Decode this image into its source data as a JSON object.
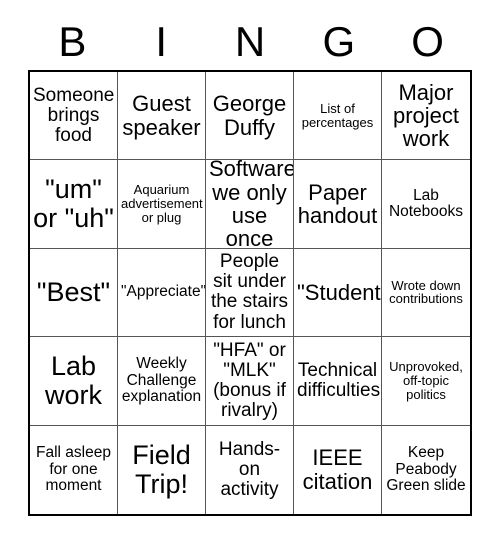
{
  "card": {
    "header_letters": [
      "B",
      "I",
      "N",
      "G",
      "O"
    ],
    "columns": 5,
    "rows": 5,
    "colors": {
      "background": "#ffffff",
      "text": "#000000",
      "grid_line": "#555555",
      "grid_border": "#000000"
    },
    "cells": [
      {
        "text": "Someone brings food",
        "size": "md"
      },
      {
        "text": "Guest speaker",
        "size": "lg"
      },
      {
        "text": "George Duffy",
        "size": "lg"
      },
      {
        "text": "List of percentages",
        "size": "xs"
      },
      {
        "text": "Major project work",
        "size": "lg"
      },
      {
        "text": "\"um\" or \"uh\"",
        "size": "xl"
      },
      {
        "text": "Aquarium advertisement or plug",
        "size": "xs"
      },
      {
        "text": "Software we only use once",
        "size": "lg"
      },
      {
        "text": "Paper handout",
        "size": "lg"
      },
      {
        "text": "Lab Notebooks",
        "size": "sm"
      },
      {
        "text": "\"Best\"",
        "size": "xl"
      },
      {
        "text": "\"Appreciate\"",
        "size": "sm"
      },
      {
        "text": "People sit under the stairs for lunch",
        "size": "md"
      },
      {
        "text": "\"Student\"",
        "size": "lg"
      },
      {
        "text": "Wrote down contributions",
        "size": "xs"
      },
      {
        "text": "Lab work",
        "size": "xl"
      },
      {
        "text": "Weekly Challenge explanation",
        "size": "sm"
      },
      {
        "text": "\"HFA\" or \"MLK\" (bonus if rivalry)",
        "size": "md"
      },
      {
        "text": "Technical difficulties",
        "size": "md"
      },
      {
        "text": "Unprovoked, off-topic politics",
        "size": "xs"
      },
      {
        "text": "Fall asleep for one moment",
        "size": "sm"
      },
      {
        "text": "Field Trip!",
        "size": "xl"
      },
      {
        "text": "Hands-on activity",
        "size": "md"
      },
      {
        "text": "IEEE citation",
        "size": "lg"
      },
      {
        "text": "Keep Peabody Green slide",
        "size": "sm"
      }
    ]
  }
}
